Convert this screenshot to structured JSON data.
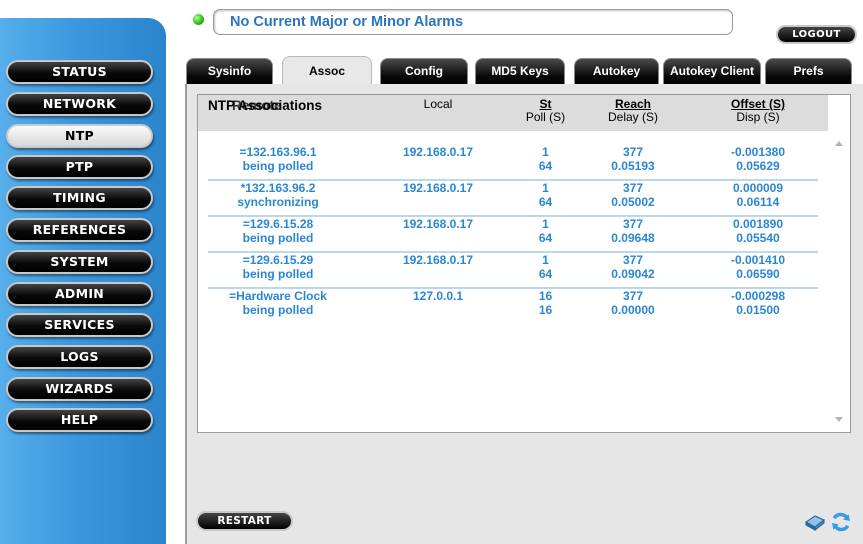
{
  "sidebar": {
    "items": [
      {
        "label": "STATUS",
        "active": false
      },
      {
        "label": "NETWORK",
        "active": false
      },
      {
        "label": "NTP",
        "active": true
      },
      {
        "label": "PTP",
        "active": false
      },
      {
        "label": "TIMING",
        "active": false
      },
      {
        "label": "REFERENCES",
        "active": false
      },
      {
        "label": "SYSTEM",
        "active": false
      },
      {
        "label": "ADMIN",
        "active": false
      },
      {
        "label": "SERVICES",
        "active": false
      },
      {
        "label": "LOGS",
        "active": false
      },
      {
        "label": "WIZARDS",
        "active": false
      },
      {
        "label": "HELP",
        "active": false
      }
    ]
  },
  "alarm": {
    "text": "No Current Major or Minor Alarms",
    "status_color": "#34c81e"
  },
  "logout_label": "LOGOUT",
  "tabs": [
    {
      "label": "Sysinfo",
      "active": false
    },
    {
      "label": "Assoc",
      "active": true
    },
    {
      "label": "Config",
      "active": false
    },
    {
      "label": "MD5 Keys",
      "active": false
    },
    {
      "label": "Autokey",
      "active": false
    },
    {
      "label": "Autokey Client",
      "active": false
    },
    {
      "label": "Prefs",
      "active": false
    }
  ],
  "section": {
    "title": "NTP Associations",
    "overlay_text": "Remote"
  },
  "table": {
    "headers": {
      "local": "Local",
      "st": "St",
      "poll": "Poll (S)",
      "reach": "Reach",
      "delay": "Delay (S)",
      "offset": "Offset (S)",
      "disp": "Disp (S)"
    },
    "rows": [
      {
        "remote": "=132.163.96.1",
        "state": "being polled",
        "local": "192.168.0.17",
        "st": "1",
        "poll": "64",
        "reach": "377",
        "delay": "0.05193",
        "offset": "-0.001380",
        "disp": "0.05629"
      },
      {
        "remote": "*132.163.96.2",
        "state": "synchronizing",
        "local": "192.168.0.17",
        "st": "1",
        "poll": "64",
        "reach": "377",
        "delay": "0.05002",
        "offset": "0.000009",
        "disp": "0.06114"
      },
      {
        "remote": "=129.6.15.28",
        "state": "being polled",
        "local": "192.168.0.17",
        "st": "1",
        "poll": "64",
        "reach": "377",
        "delay": "0.09648",
        "offset": "0.001890",
        "disp": "0.05540"
      },
      {
        "remote": "=129.6.15.29",
        "state": "being polled",
        "local": "192.168.0.17",
        "st": "1",
        "poll": "64",
        "reach": "377",
        "delay": "0.09042",
        "offset": "-0.001410",
        "disp": "0.06590"
      },
      {
        "remote": "=Hardware Clock",
        "state": "being polled",
        "local": "127.0.0.1",
        "st": "16",
        "poll": "16",
        "reach": "377",
        "delay": "0.00000",
        "offset": "-0.000298",
        "disp": "0.01500"
      }
    ]
  },
  "restart_label": "RESTART",
  "colors": {
    "accent": "#2b86d2",
    "sidebar": "#3c98dd"
  }
}
